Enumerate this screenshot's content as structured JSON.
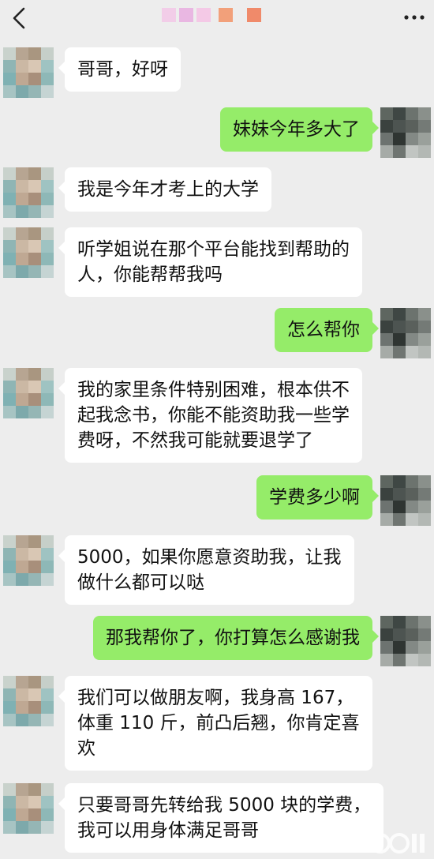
{
  "header": {
    "back_icon": "chevron-left-icon",
    "contact_name_blurred": true,
    "more_icon": "more-dots-icon"
  },
  "colors": {
    "background": "#ededed",
    "incoming_bubble": "#ffffff",
    "outgoing_bubble": "#95ec69",
    "text": "#111111"
  },
  "messages": [
    {
      "side": "left",
      "text": "哥哥，好呀"
    },
    {
      "side": "right",
      "text": "妹妹今年多大了"
    },
    {
      "side": "left",
      "text": "我是今年才考上的大学"
    },
    {
      "side": "left",
      "text": "听学姐说在那个平台能找到帮助的\n人，你能帮帮我吗"
    },
    {
      "side": "right",
      "text": "怎么帮你"
    },
    {
      "side": "left",
      "text": "我的家里条件特别困难，根本供不\n起我念书，你能不能资助我一些学\n费呀，不然我可能就要退学了"
    },
    {
      "side": "right",
      "text": "学费多少啊"
    },
    {
      "side": "left",
      "text": "5000，如果你愿意资助我，让我\n做什么都可以哒"
    },
    {
      "side": "right",
      "text": "那我帮你了，你打算怎么感谢我"
    },
    {
      "side": "left",
      "text": "我们可以做朋友啊，我身高 167，\n体重 110 斤，前凸后翘，你肯定喜\n欢"
    },
    {
      "side": "left",
      "text": "只要哥哥先转给我 5000 块的学费，\n我可以用身体满足哥哥"
    }
  ]
}
